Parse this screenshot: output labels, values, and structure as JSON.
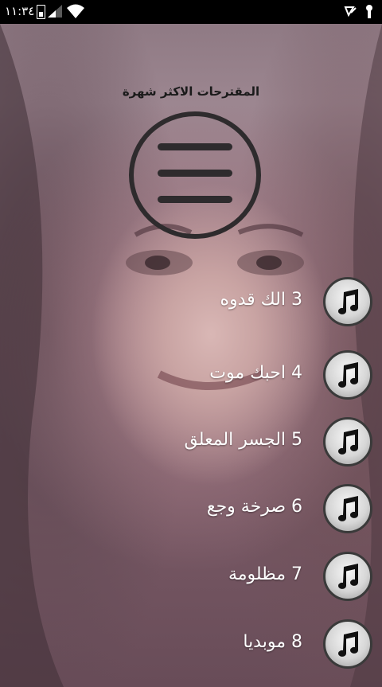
{
  "status_bar": {
    "time": "١١:٣٤",
    "icons": [
      "battery-icon",
      "signal-icon",
      "wifi-icon",
      "notification-icon",
      "lock-icon"
    ]
  },
  "header": {
    "title": "المقترحات الاكثر شهرة",
    "menu_icon": "menu-icon"
  },
  "songs": [
    {
      "label": "3 الك قدوه",
      "icon": "music-note-icon"
    },
    {
      "label": "4 احبك موت",
      "icon": "music-note-icon"
    },
    {
      "label": "5 الجسر المعلق",
      "icon": "music-note-icon"
    },
    {
      "label": "6 صرخة وجع",
      "icon": "music-note-icon"
    },
    {
      "label": "7 مظلومة",
      "icon": "music-note-icon"
    },
    {
      "label": "8 موبديا",
      "icon": "music-note-icon"
    }
  ]
}
